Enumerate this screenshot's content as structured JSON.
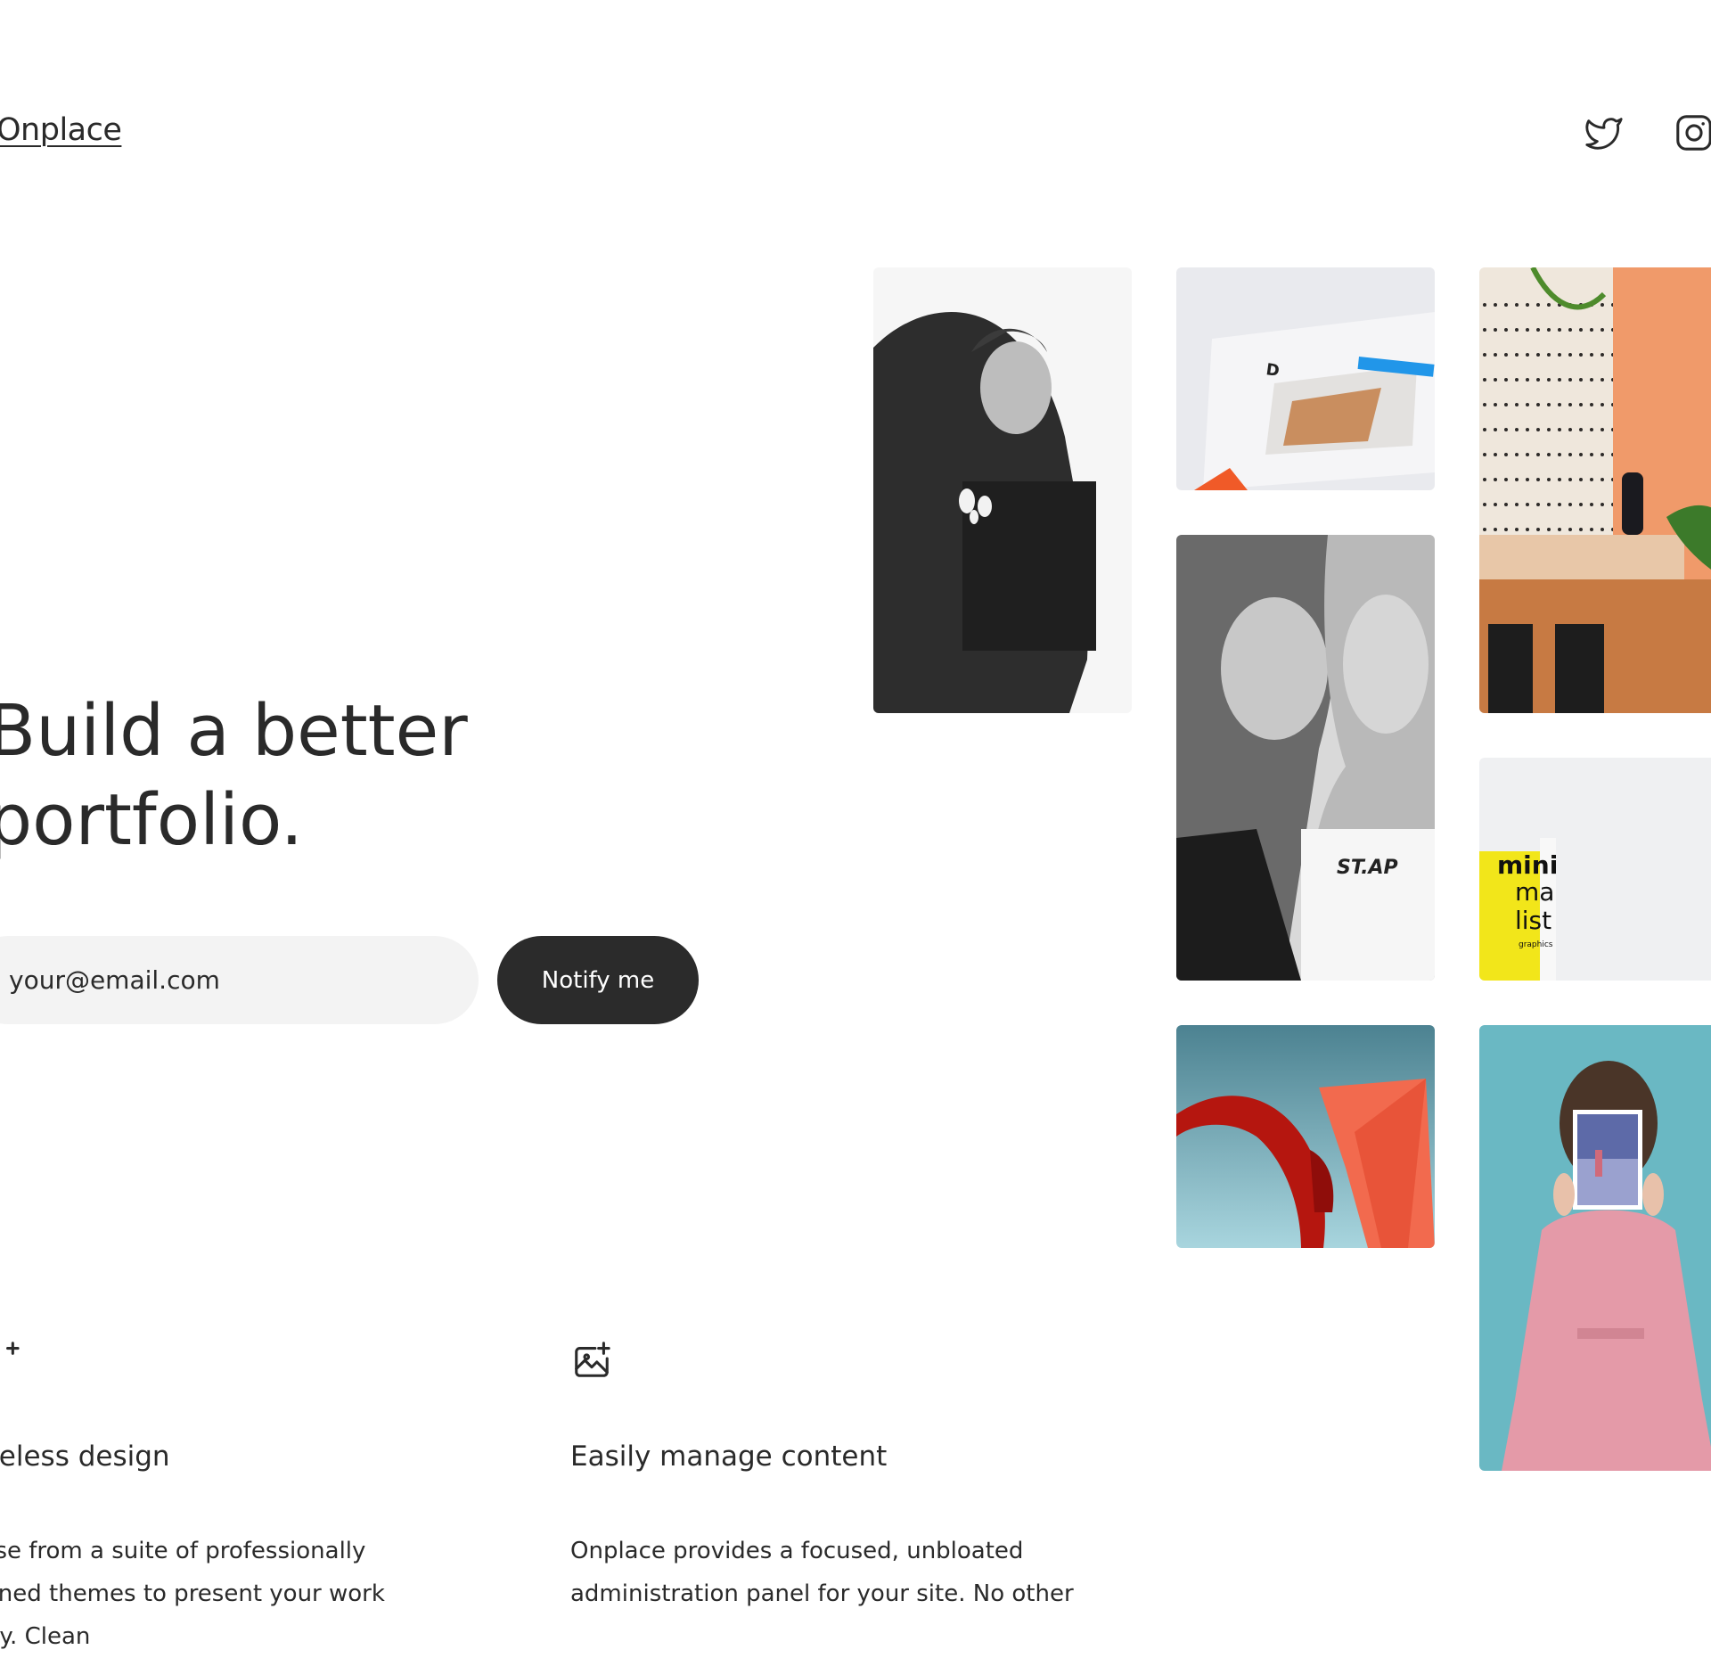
{
  "header": {
    "logo": "Onplace",
    "social": [
      {
        "name": "twitter",
        "icon": "twitter-icon"
      },
      {
        "name": "instagram",
        "icon": "instagram-icon"
      }
    ]
  },
  "hero": {
    "title_line1": "Build a better",
    "title_line2": "portfolio.",
    "email_placeholder": "your@email.com",
    "notify_label": "Notify me"
  },
  "gallery": [
    {
      "name": "man-black-and-white-photo",
      "description": "black and white portrait"
    },
    {
      "name": "printed-page-photo",
      "description": "printed page close-up"
    },
    {
      "name": "pegboard-interior-photo",
      "description": "pegboard interior"
    },
    {
      "name": "two-women-portrait-photo",
      "description": "two women portrait"
    },
    {
      "name": "magazine-cover-photo",
      "description": "yellow magazine"
    },
    {
      "name": "red-sculpture-photo",
      "description": "red sculpture"
    },
    {
      "name": "woman-holding-magazine-photo",
      "description": "woman holding magazine"
    }
  ],
  "features": [
    {
      "icon": "sparkle-icon",
      "title": "Timeless design",
      "description": "Choose from a suite of professionally designed themes to present your work clearly. Clean"
    },
    {
      "icon": "image-add-icon",
      "title": "Easily manage content",
      "description": "Onplace provides a focused, unbloated administration panel for your site. No other"
    }
  ],
  "colors": {
    "text": "#2a2a2a",
    "button_bg": "#2b2b2b",
    "input_bg": "#f3f3f3"
  }
}
